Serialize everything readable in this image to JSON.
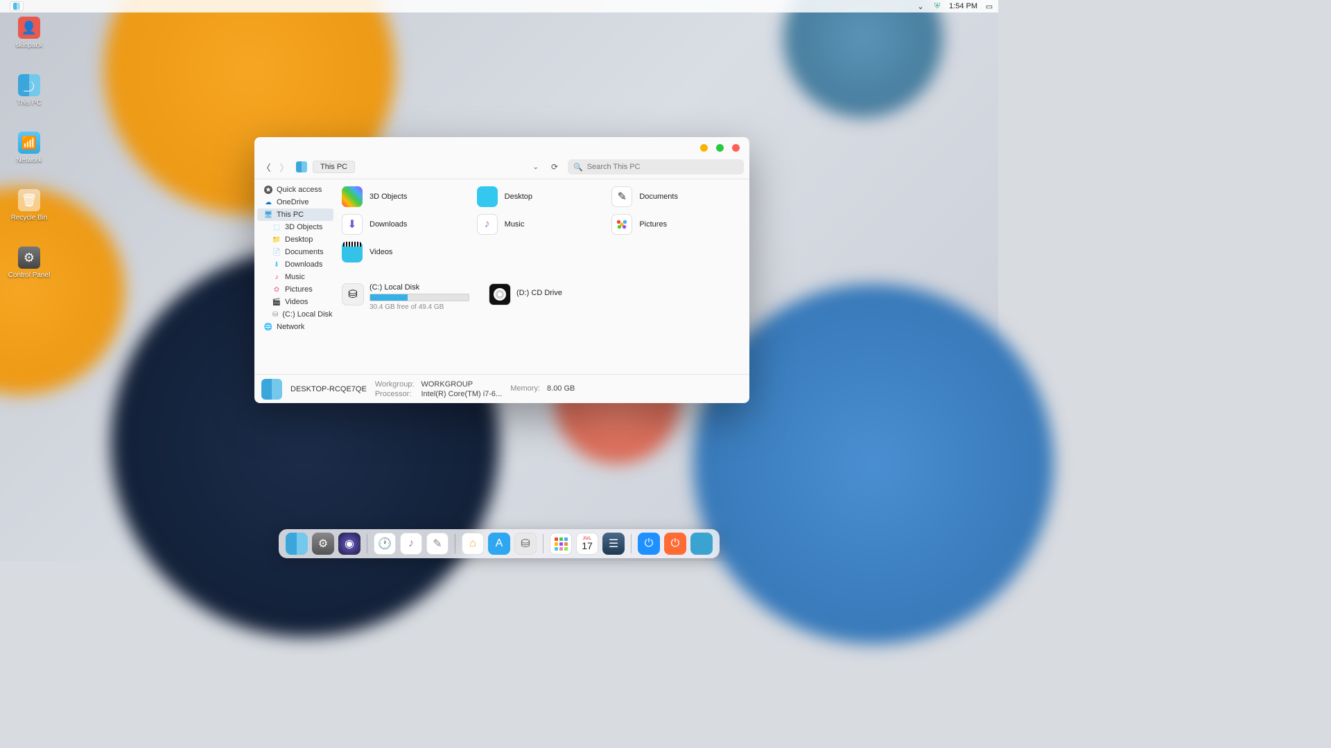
{
  "menubar": {
    "time": "1:54 PM"
  },
  "desktop": {
    "icons": [
      {
        "label": "skinpack"
      },
      {
        "label": "This PC"
      },
      {
        "label": "Network"
      },
      {
        "label": "Recycle Bin"
      },
      {
        "label": "Control Panel"
      }
    ]
  },
  "window": {
    "breadcrumb": "This PC",
    "search_placeholder": "Search This PC",
    "sidebar": [
      {
        "label": "Quick access"
      },
      {
        "label": "OneDrive"
      },
      {
        "label": "This PC",
        "selected": true
      },
      {
        "label": "3D Objects",
        "child": true
      },
      {
        "label": "Desktop",
        "child": true
      },
      {
        "label": "Documents",
        "child": true
      },
      {
        "label": "Downloads",
        "child": true
      },
      {
        "label": "Music",
        "child": true
      },
      {
        "label": "Pictures",
        "child": true
      },
      {
        "label": "Videos",
        "child": true
      },
      {
        "label": "(C:) Local Disk",
        "child": true
      },
      {
        "label": "Network"
      }
    ],
    "folders": [
      {
        "label": "3D Objects"
      },
      {
        "label": "Desktop"
      },
      {
        "label": "Documents"
      },
      {
        "label": "Downloads"
      },
      {
        "label": "Music"
      },
      {
        "label": "Pictures"
      },
      {
        "label": "Videos"
      }
    ],
    "drives": {
      "c": {
        "name": "(C:) Local Disk",
        "free": "30.4 GB free of 49.4 GB",
        "fill_pct": 38
      },
      "d": {
        "name": "(D:) CD Drive"
      }
    },
    "status": {
      "computer": "DESKTOP-RCQE7QE",
      "workgroup_lbl": "Workgroup:",
      "workgroup": "WORKGROUP",
      "processor_lbl": "Processor:",
      "processor": "Intel(R) Core(TM) i7-6...",
      "memory_lbl": "Memory:",
      "memory": "8.00 GB"
    }
  },
  "dock": {
    "calendar": {
      "month": "JUL",
      "day": "17"
    }
  }
}
